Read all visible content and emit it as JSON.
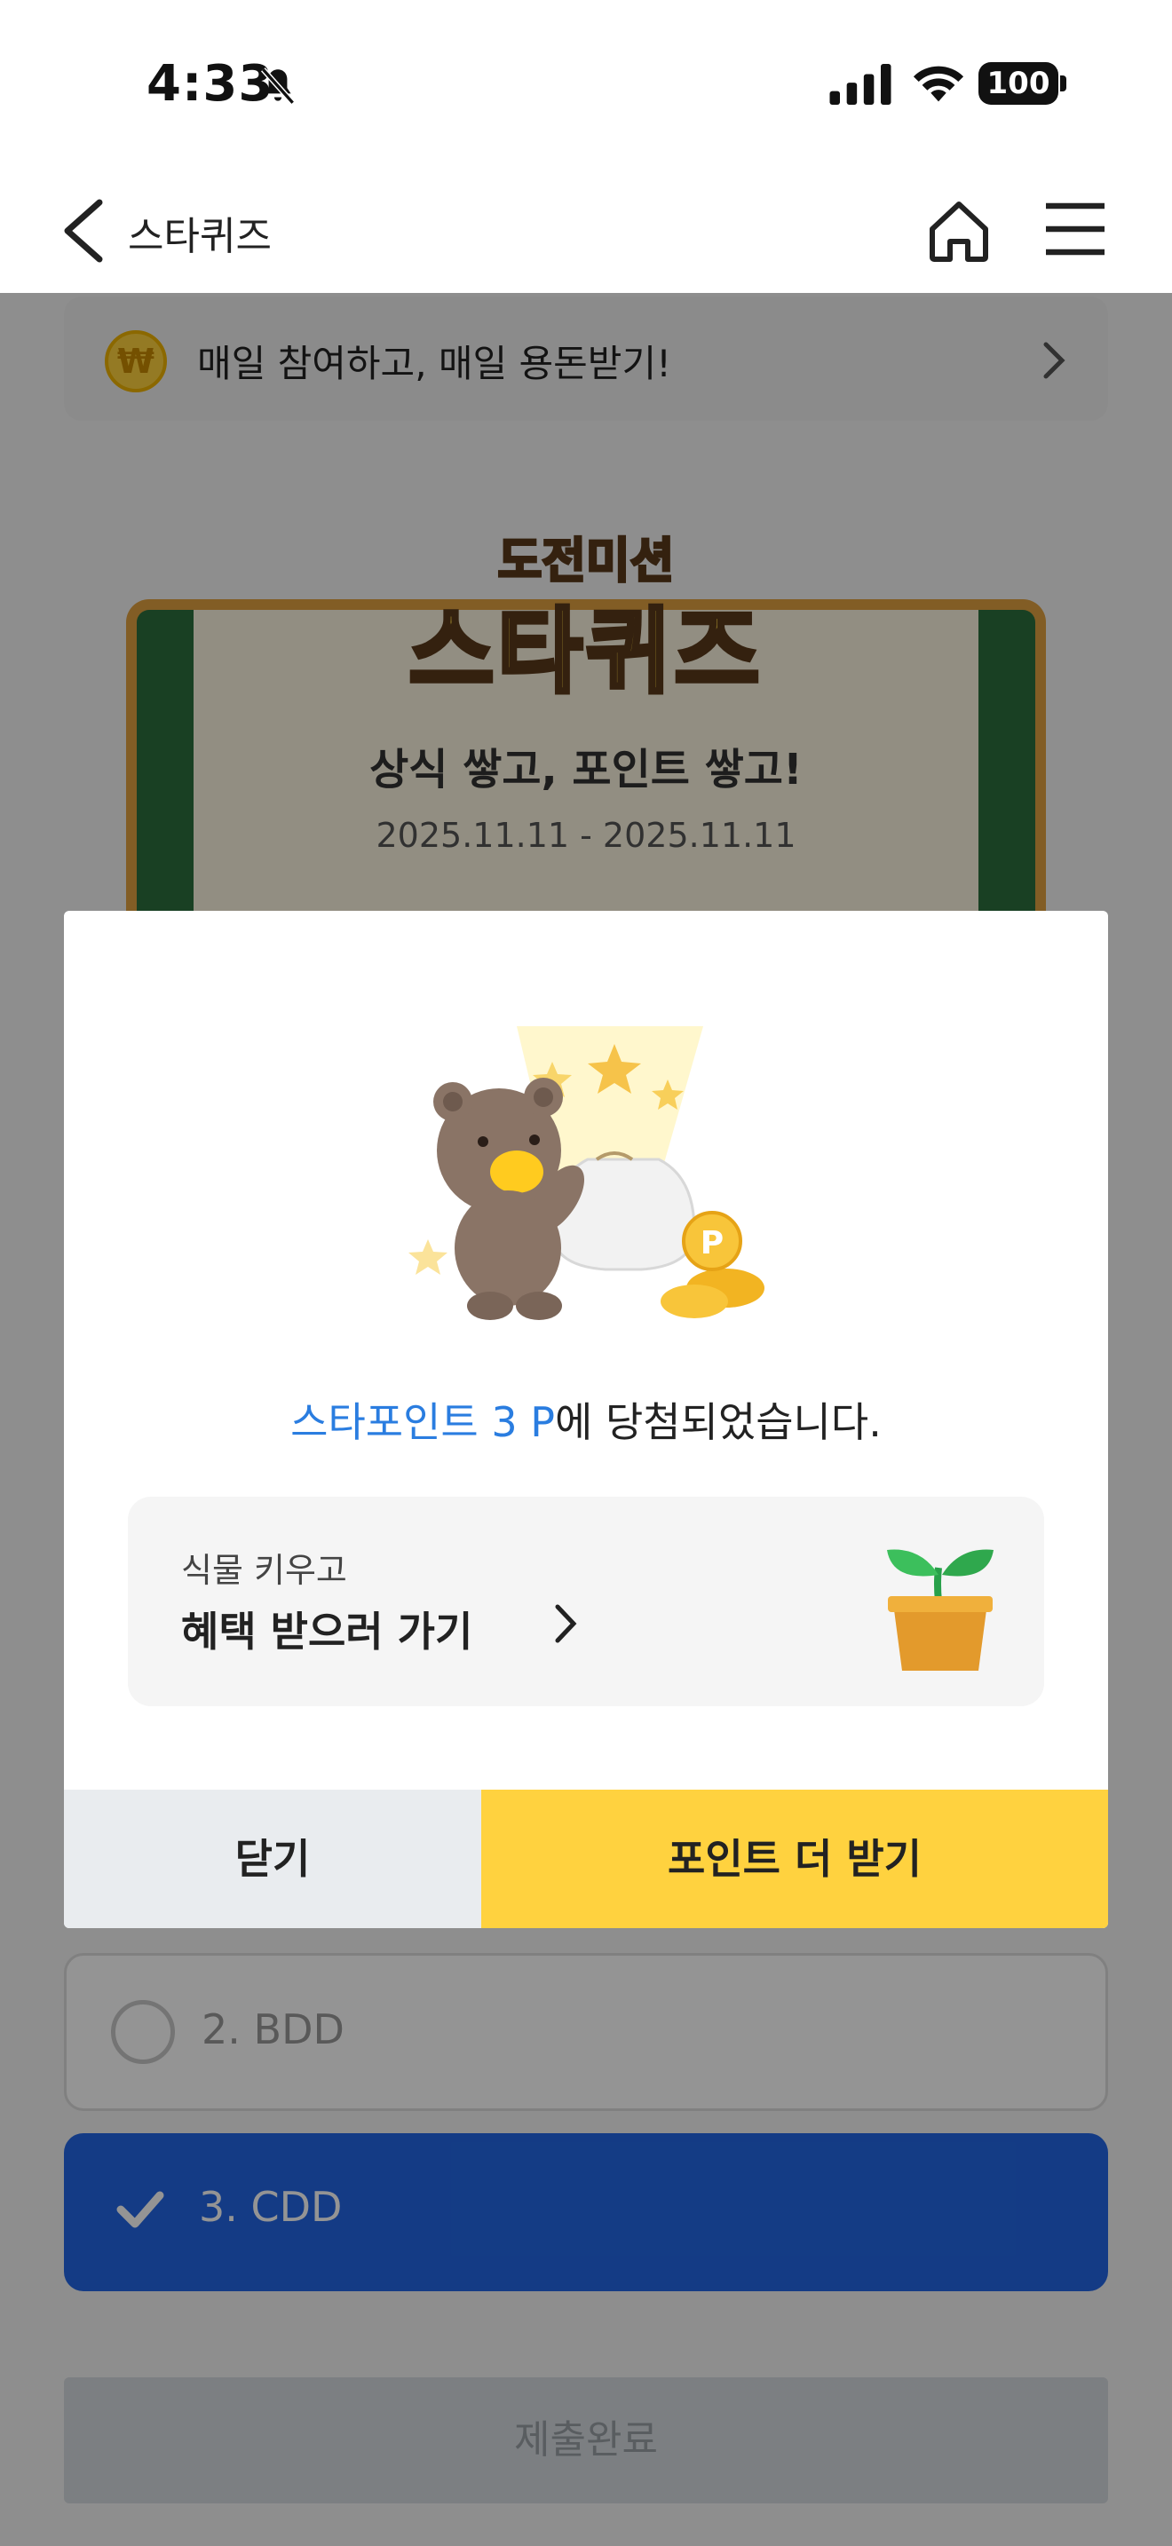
{
  "status_bar": {
    "time": "4:33",
    "battery": "100"
  },
  "header": {
    "title": "스타퀴즈"
  },
  "promo_banner": {
    "coin_symbol": "₩",
    "text": "매일 참여하고, 매일 용돈받기!"
  },
  "quiz_card": {
    "logo_sub": "도전미션",
    "logo_main": "스타퀴즈",
    "subtitle": "상식 쌓고, 포인트 쌓고!",
    "date_range": "2025.11.11 - 2025.11.11"
  },
  "options": [
    {
      "label": "2. BDD",
      "selected": false
    },
    {
      "label": "3. CDD",
      "selected": true
    }
  ],
  "submit": {
    "label": "제출완료"
  },
  "modal": {
    "win_highlight": "스타포인트 3 P",
    "win_rest": "에 당첨되었습니다.",
    "benefit_sub": "식물 키우고",
    "benefit_main": "혜택 받으러 가기",
    "close_label": "닫기",
    "more_label": "포인트 더 받기"
  },
  "colors": {
    "accent_blue": "#2a7de0",
    "primary_yellow": "#ffd23f",
    "selected_option": "#2367e6"
  },
  "icons": {
    "header": [
      "back-icon",
      "home-icon",
      "menu-icon"
    ],
    "status": [
      "bell-muted-icon",
      "signal-icon",
      "wifi-icon",
      "battery-icon"
    ]
  }
}
